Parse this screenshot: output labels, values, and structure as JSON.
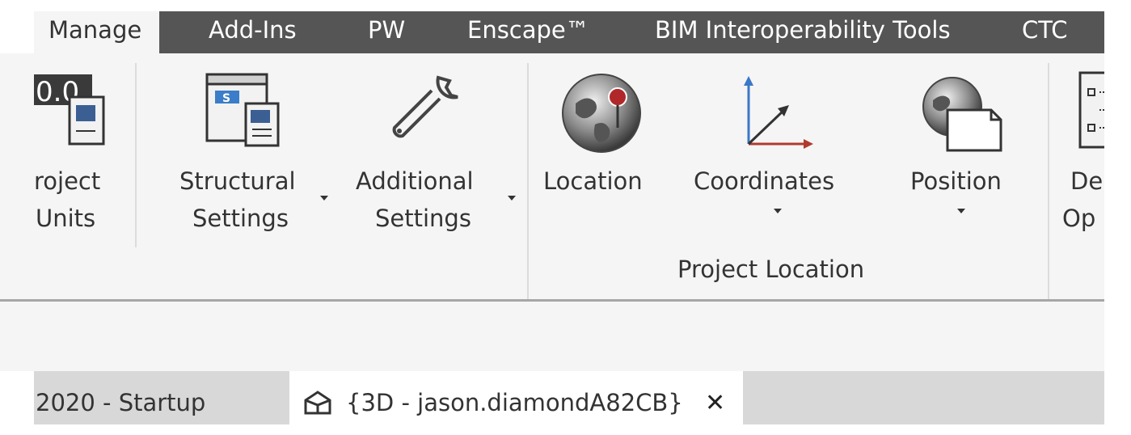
{
  "ribbon_tabs": [
    {
      "label": "Manage",
      "active": true
    },
    {
      "label": "Add-Ins"
    },
    {
      "label": "PW"
    },
    {
      "label": "Enscape™"
    },
    {
      "label": "BIM Interoperability Tools"
    },
    {
      "label": "CTC"
    }
  ],
  "buttons": {
    "project_units": {
      "line1": "roject",
      "line2": "Units",
      "icon_text": "0.0"
    },
    "structural_settings": {
      "line1": "Structural",
      "line2": "Settings",
      "icon_text": "S"
    },
    "additional_settings": {
      "line1": "Additional",
      "line2": "Settings"
    },
    "location": {
      "line1": "Location"
    },
    "coordinates": {
      "line1": "Coordinates"
    },
    "position": {
      "line1": "Position"
    },
    "design_options": {
      "line1": "De",
      "line2": "Op"
    }
  },
  "panels": {
    "project_location": "Project Location"
  },
  "doc_tabs": [
    {
      "label": "2020 - Startup",
      "active": false
    },
    {
      "label": "{3D - jason.diamondA82CB}",
      "active": true,
      "close": "✕"
    }
  ],
  "colors": {
    "tabbar_bg": "#555555",
    "ribbon_bg": "#f5f5f5",
    "doc_tabs_bg": "#d8d8d8",
    "pin_red": "#b0282a",
    "axis_blue": "#3a78c8",
    "axis_red": "#b03a2e"
  }
}
